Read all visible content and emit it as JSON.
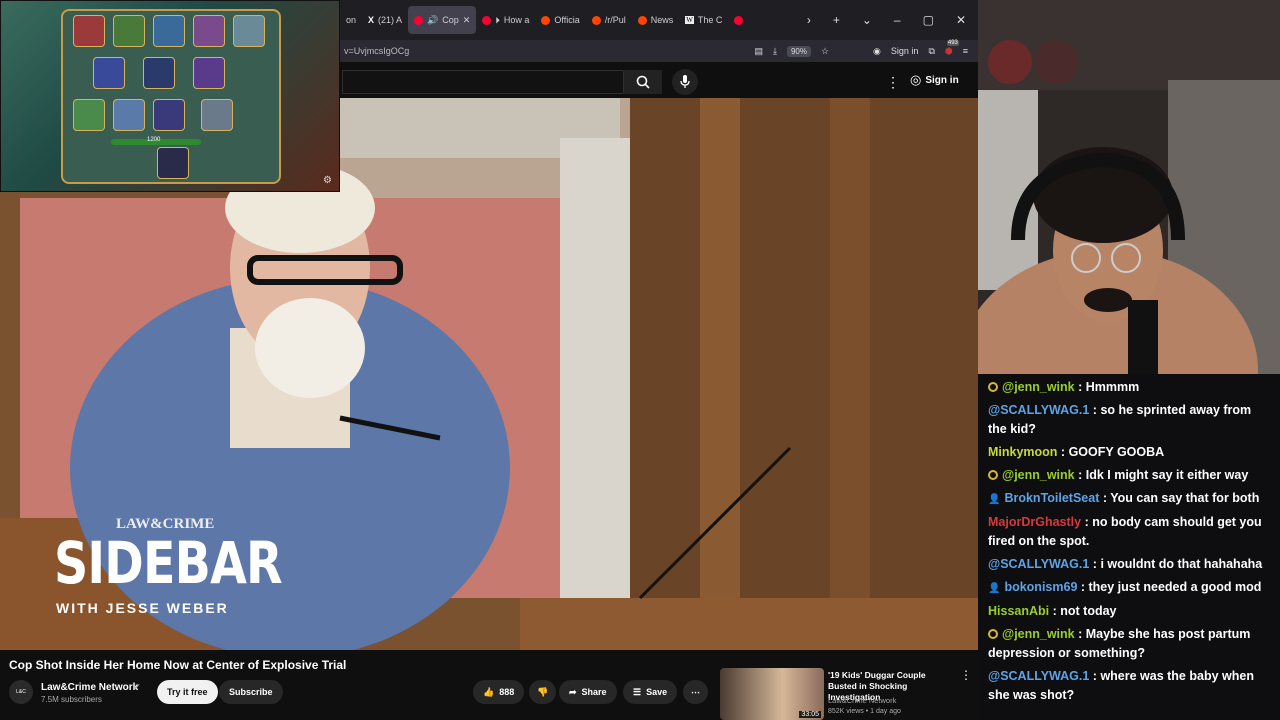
{
  "browser": {
    "tabs": [
      {
        "label": "on",
        "color": "#888888"
      },
      {
        "label": "(21) A",
        "color": "#ffffff",
        "icon": "x-logo-icon"
      },
      {
        "label": "Cop",
        "color": "#ff0033",
        "active": true,
        "icon": "speaker-icon"
      },
      {
        "label": "How a",
        "color": "#ff0033"
      },
      {
        "label": "Officia",
        "color": "#ff4500"
      },
      {
        "label": "/r/Pul",
        "color": "#ff4500"
      },
      {
        "label": "News",
        "color": "#ff4500"
      },
      {
        "label": "The C",
        "color": "#cccccc",
        "icon": "wikipedia-icon"
      }
    ],
    "url": "v=UvjmcsIgOCg",
    "zoom": "90%",
    "signin_label": "Sign in",
    "ext_badge": "493"
  },
  "youtube": {
    "signin_label": "Sign in",
    "video_title": "Cop Shot Inside Her Home Now at Center of Explosive Trial",
    "channel_name": "Law&Crime Network",
    "subscribers": "7.5M subscribers",
    "try_label": "Try it free",
    "subscribe_label": "Subscribe",
    "likes": "888",
    "share_label": "Share",
    "save_label": "Save",
    "overlay": {
      "brand": "LAW&CRIME",
      "title": "SIDEBAR",
      "with": "WITH JESSE WEBER"
    },
    "recommended": {
      "title": "'19 Kids' Duggar Couple Busted in Shocking Investigation",
      "channel": "Law&Crime Network",
      "meta": "852K views • 1 day ago",
      "duration": "33:05"
    }
  },
  "game": {
    "health": "1200"
  },
  "chat": [
    {
      "user": "@jenn_wink",
      "color": "#9acd32",
      "badge": "mod",
      "text": "Hmmmm"
    },
    {
      "user": "@SCALLYWAG.1",
      "color": "#5ea3e6",
      "badge": "",
      "text": "so he sprinted away from the kid?"
    },
    {
      "user": "Minkymoon",
      "color": "#c8d93a",
      "badge": "",
      "text": "GOOFY GOOBA"
    },
    {
      "user": "@jenn_wink",
      "color": "#9acd32",
      "badge": "mod",
      "text": "Idk I might say it either way"
    },
    {
      "user": "BroknToiletSeat",
      "color": "#5ea3e6",
      "badge": "user",
      "text": "You can say that for both"
    },
    {
      "user": "MajorDrGhastly",
      "color": "#d63a3a",
      "badge": "",
      "text": "no body cam should get you fired on the spot."
    },
    {
      "user": "@SCALLYWAG.1",
      "color": "#5ea3e6",
      "badge": "",
      "text": "i wouldnt do that hahahaha"
    },
    {
      "user": "bokonism69",
      "color": "#5ea3e6",
      "badge": "user",
      "text": "they just needed a good mod"
    },
    {
      "user": "HissanAbi",
      "color": "#9acd32",
      "badge": "",
      "text": "not today"
    },
    {
      "user": "@jenn_wink",
      "color": "#9acd32",
      "badge": "mod",
      "text": "Maybe she has post partum depression or something?"
    },
    {
      "user": "@SCALLYWAG.1",
      "color": "#5ea3e6",
      "badge": "",
      "text": "where was the baby when she was shot?"
    }
  ],
  "colors": {
    "accent_red": "#ff0033",
    "chat_bg": "#0e0e10",
    "yt_bg": "#0f0f0f"
  }
}
